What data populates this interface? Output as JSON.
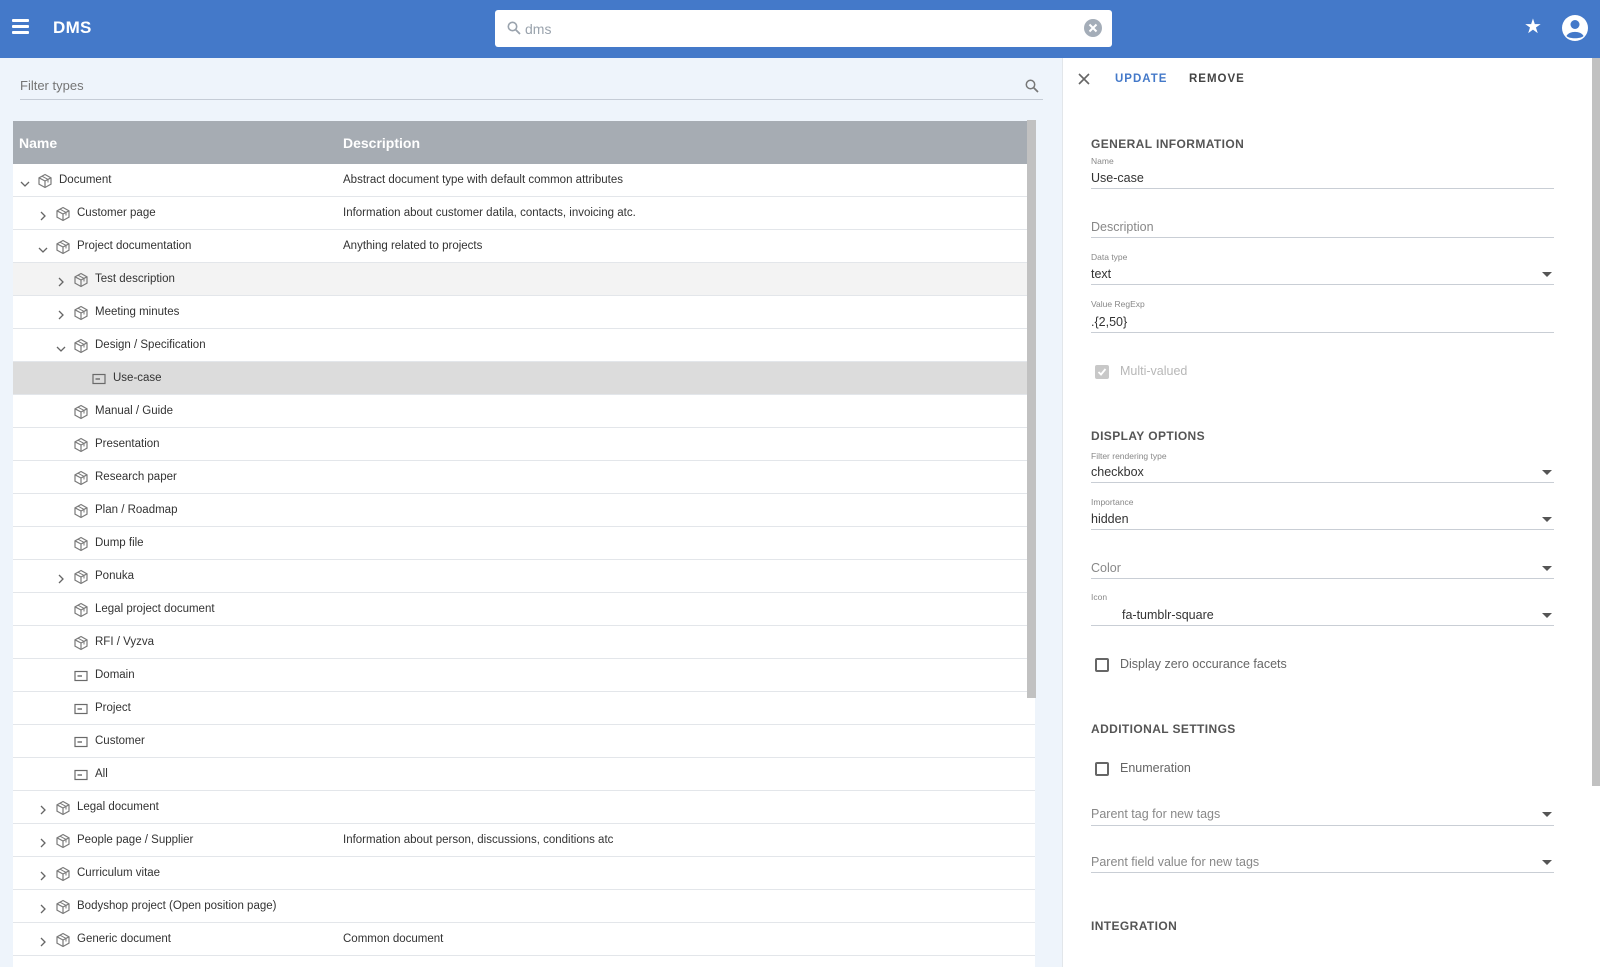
{
  "header": {
    "app_title": "DMS",
    "search_value": "dms",
    "icons": [
      "menu-icon",
      "search-icon",
      "clear-icon",
      "star-icon",
      "account-icon"
    ]
  },
  "filter": {
    "placeholder": "Filter types"
  },
  "table": {
    "columns": [
      "Name",
      "Description"
    ],
    "rows": [
      {
        "name": "Document",
        "desc": "Abstract document type with default common attributes",
        "level": 0,
        "chevron": "down",
        "icon": "type-icon"
      },
      {
        "name": "Customer page",
        "desc": "Information about customer datila, contacts, invoicing atc.",
        "level": 1,
        "chevron": "right",
        "icon": "type-icon"
      },
      {
        "name": "Project documentation",
        "desc": "Anything related to projects",
        "level": 1,
        "chevron": "down",
        "icon": "type-icon"
      },
      {
        "name": "Test description",
        "desc": "",
        "level": 2,
        "chevron": "right",
        "icon": "type-icon",
        "state": "hover"
      },
      {
        "name": "Meeting minutes",
        "desc": "",
        "level": 2,
        "chevron": "right",
        "icon": "type-icon"
      },
      {
        "name": "Design / Specification",
        "desc": "",
        "level": 2,
        "chevron": "down",
        "icon": "type-icon"
      },
      {
        "name": "Use-case",
        "desc": "",
        "level": 3,
        "chevron": "",
        "icon": "field-icon",
        "state": "selected"
      },
      {
        "name": "Manual / Guide",
        "desc": "",
        "level": 2,
        "chevron": "",
        "icon": "type-icon"
      },
      {
        "name": "Presentation",
        "desc": "",
        "level": 2,
        "chevron": "",
        "icon": "type-icon"
      },
      {
        "name": "Research paper",
        "desc": "",
        "level": 2,
        "chevron": "",
        "icon": "type-icon"
      },
      {
        "name": "Plan / Roadmap",
        "desc": "",
        "level": 2,
        "chevron": "",
        "icon": "type-icon"
      },
      {
        "name": "Dump file",
        "desc": "",
        "level": 2,
        "chevron": "",
        "icon": "type-icon"
      },
      {
        "name": "Ponuka",
        "desc": "",
        "level": 2,
        "chevron": "right",
        "icon": "type-icon"
      },
      {
        "name": "Legal project document",
        "desc": "",
        "level": 2,
        "chevron": "",
        "icon": "type-icon"
      },
      {
        "name": "RFI / Vyzva",
        "desc": "",
        "level": 2,
        "chevron": "",
        "icon": "type-icon"
      },
      {
        "name": "Domain",
        "desc": "",
        "level": 2,
        "chevron": "",
        "icon": "field-icon"
      },
      {
        "name": "Project",
        "desc": "",
        "level": 2,
        "chevron": "",
        "icon": "field-icon"
      },
      {
        "name": "Customer",
        "desc": "",
        "level": 2,
        "chevron": "",
        "icon": "field-icon"
      },
      {
        "name": "All",
        "desc": "",
        "level": 2,
        "chevron": "",
        "icon": "field-icon"
      },
      {
        "name": "Legal document",
        "desc": "",
        "level": 1,
        "chevron": "right",
        "icon": "type-icon"
      },
      {
        "name": "People page / Supplier",
        "desc": "Information about person, discussions, conditions atc",
        "level": 1,
        "chevron": "right",
        "icon": "type-icon"
      },
      {
        "name": "Curriculum vitae",
        "desc": "",
        "level": 1,
        "chevron": "right",
        "icon": "type-icon"
      },
      {
        "name": "Bodyshop project (Open position page)",
        "desc": "",
        "level": 1,
        "chevron": "right",
        "icon": "type-icon"
      },
      {
        "name": "Generic document",
        "desc": "Common document",
        "level": 1,
        "chevron": "right",
        "icon": "type-icon"
      }
    ]
  },
  "details": {
    "actions": {
      "update": "UPDATE",
      "remove": "REMOVE"
    },
    "general": {
      "title": "GENERAL INFORMATION",
      "name_label": "Name",
      "name_value": "Use-case",
      "description_placeholder": "Description",
      "data_type_label": "Data type",
      "data_type_value": "text",
      "regexp_label": "Value RegExp",
      "regexp_value": ".{2,50}",
      "multi_valued_label": "Multi-valued",
      "multi_valued_checked": true
    },
    "display": {
      "title": "DISPLAY OPTIONS",
      "filter_label": "Filter rendering type",
      "filter_value": "checkbox",
      "importance_label": "Importance",
      "importance_value": "hidden",
      "color_placeholder": "Color",
      "icon_label": "Icon",
      "icon_value": "fa-tumblr-square",
      "zero_facets_label": "Display zero occurance facets",
      "zero_facets_checked": false
    },
    "additional": {
      "title": "ADDITIONAL SETTINGS",
      "enumeration_label": "Enumeration",
      "enumeration_checked": false,
      "parent_tag_placeholder": "Parent tag for new tags",
      "parent_field_placeholder": "Parent field value for new tags"
    },
    "integration": {
      "title": "INTEGRATION"
    }
  },
  "colors": {
    "header": "#4479c9",
    "accent": "#4479c9",
    "table_header": "#a6acb3",
    "selected_row": "#dcdcdc"
  }
}
